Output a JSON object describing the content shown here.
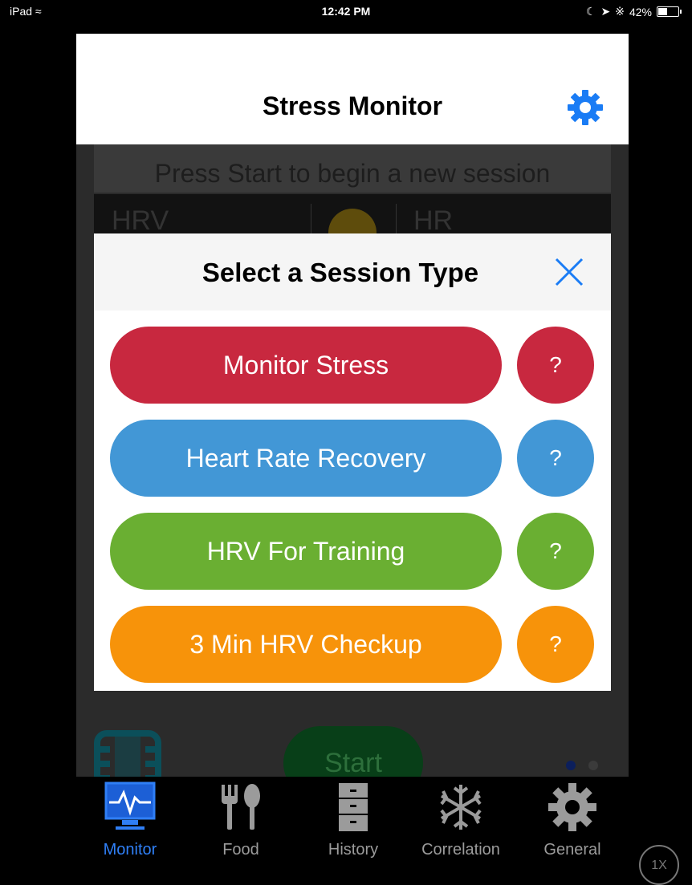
{
  "status_bar": {
    "device": "iPad",
    "time": "12:42 PM",
    "battery": "42%",
    "battery_level": 0.42
  },
  "navbar": {
    "title": "Stress Monitor",
    "settings_icon": "gear-icon"
  },
  "background": {
    "prompt": "Press Start to begin a new session",
    "hrv_label": "HRV",
    "hr_label": "HR",
    "start_label": "Start"
  },
  "modal": {
    "title": "Select a Session Type",
    "close_icon": "close-icon",
    "sessions": [
      {
        "label": "Monitor Stress",
        "help": "?",
        "color": "#c8283f"
      },
      {
        "label": "Heart Rate Recovery",
        "help": "?",
        "color": "#4297d6"
      },
      {
        "label": "HRV For Training",
        "help": "?",
        "color": "#6aaf32"
      },
      {
        "label": "3 Min HRV Checkup",
        "help": "?",
        "color": "#f7930a"
      }
    ]
  },
  "tabs": [
    {
      "label": "Monitor",
      "icon": "monitor-icon",
      "active": true
    },
    {
      "label": "Food",
      "icon": "fork-spoon-icon",
      "active": false
    },
    {
      "label": "History",
      "icon": "filing-cabinet-icon",
      "active": false
    },
    {
      "label": "Correlation",
      "icon": "snowflake-icon",
      "active": false
    },
    {
      "label": "General",
      "icon": "gear-icon",
      "active": false
    }
  ],
  "zoom": "1X",
  "colors": {
    "accent": "#2f7ff6",
    "active_tab": "#2f7ff6"
  }
}
